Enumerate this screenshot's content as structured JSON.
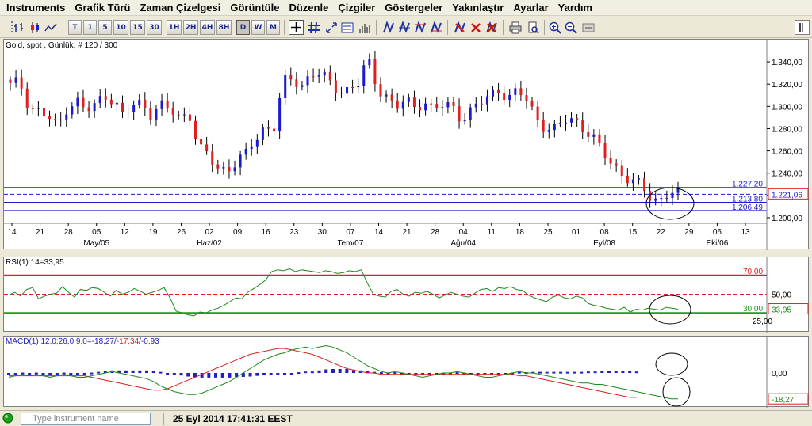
{
  "menu": [
    "Instruments",
    "Grafik Türü",
    "Zaman Çizelgesi",
    "Görüntüle",
    "Düzenle",
    "Çizgiler",
    "Göstergeler",
    "Yakınlaştır",
    "Ayarlar",
    "Yardım"
  ],
  "toolbar": {
    "period_buttons": [
      "T",
      "1",
      "5",
      "10",
      "15",
      "30",
      "1H",
      "2H",
      "4H",
      "8H",
      "D",
      "W",
      "M"
    ],
    "selected_period": "D"
  },
  "price_pane": {
    "title": "Gold, spot , Günlük, # 120 / 300",
    "axis_ticks": [
      "1.340,00",
      "1.320,00",
      "1.300,00",
      "1.280,00",
      "1.260,00",
      "1.240,00",
      "1.220,00",
      "1.200,00"
    ],
    "hlines": [
      {
        "label": "1.227,20",
        "value": 1227.2
      },
      {
        "label": "1.213,80",
        "value": 1213.8
      },
      {
        "label": "1.206,49",
        "value": 1206.49
      }
    ],
    "dashed_line_value": 1221.06,
    "last_price": "1.221,06",
    "day_labels": [
      "14",
      "21",
      "28",
      "05",
      "12",
      "19",
      "26",
      "02",
      "09",
      "16",
      "23",
      "30",
      "07",
      "14",
      "21",
      "28",
      "04",
      "11",
      "18",
      "25",
      "01",
      "08",
      "15",
      "22",
      "29",
      "06",
      "13"
    ],
    "month_labels": [
      {
        "text": "May/05",
        "index": 3
      },
      {
        "text": "Haz/02",
        "index": 7
      },
      {
        "text": "Tem/07",
        "index": 12
      },
      {
        "text": "Ağu/04",
        "index": 16
      },
      {
        "text": "Eyl/08",
        "index": 21
      },
      {
        "text": "Eki/06",
        "index": 25
      }
    ],
    "colors": {
      "up": "#1a1ad0",
      "down": "#e02020",
      "hline": "#1a1ad0"
    }
  },
  "rsi_pane": {
    "title": "RSI(1) 14=33,95",
    "levels": [
      {
        "label": "70,00",
        "value": 70,
        "color": "#e02020"
      },
      {
        "label": "30,00",
        "value": 30,
        "color": "#1aa01a"
      }
    ],
    "axis_ticks": [
      "50,00",
      "25,00"
    ],
    "last_value": "33,95",
    "series": [
      49,
      52,
      48,
      55,
      57,
      45,
      48,
      50,
      51,
      58,
      52,
      47,
      55,
      54,
      57,
      56,
      52,
      48,
      54,
      50,
      52,
      56,
      53,
      50,
      52,
      54,
      57,
      46,
      32,
      30,
      28,
      27,
      31,
      30,
      33,
      35,
      38,
      42,
      46,
      45,
      52,
      56,
      60,
      65,
      74,
      76,
      75,
      77,
      74,
      76,
      75,
      74,
      73,
      75,
      74,
      72,
      73,
      75,
      74,
      76,
      62,
      50,
      48,
      47,
      53,
      55,
      50,
      48,
      52,
      51,
      53,
      50,
      46,
      49,
      52,
      50,
      48,
      47,
      51,
      55,
      56,
      53,
      57,
      56,
      58,
      55,
      54,
      49,
      46,
      44,
      42,
      47,
      49,
      46,
      45,
      48,
      46,
      40,
      38,
      37,
      35,
      34,
      33,
      36,
      31,
      34,
      33,
      35,
      34,
      33,
      36,
      35,
      34
    ],
    "colors": {
      "line": "#1a8a1a"
    }
  },
  "macd_pane": {
    "title_prefix": "MACD(1) 12,0;26,0;9,0=",
    "title_main": "-18,27",
    "title_sep": "/",
    "title_signal": "-17,34",
    "title_hist": "/-0,93",
    "axis_ticks": [
      "0,00"
    ],
    "last_value": "-18,27",
    "macd": [
      -3,
      -2,
      -1,
      -2,
      -1,
      -2,
      -3,
      -2,
      -1,
      -2,
      -3,
      -3,
      -2,
      -1,
      0,
      1,
      0,
      -1,
      -2,
      -3,
      -4,
      -6,
      -9,
      -11,
      -13,
      -14,
      -15,
      -15,
      -14,
      -12,
      -10,
      -8,
      -6,
      -3,
      0,
      3,
      6,
      9,
      11,
      13,
      14,
      16,
      17,
      18,
      17,
      18,
      19,
      18,
      16,
      14,
      11,
      8,
      5,
      3,
      1,
      0,
      1,
      0,
      -1,
      -2,
      -3,
      -2,
      -1,
      0,
      0,
      1,
      0,
      -1,
      -2,
      -3,
      -3,
      -2,
      -1,
      0,
      1,
      0,
      0,
      -1,
      -2,
      -3,
      -4,
      -5,
      -6,
      -7,
      -7,
      -8,
      -8,
      -9,
      -10,
      -11,
      -12,
      -13,
      -14,
      -15,
      -16,
      -17,
      -18,
      -18
    ],
    "signal": [
      -2,
      -2,
      -2,
      -2,
      -2,
      -2,
      -2,
      -2,
      -2,
      -2,
      -2,
      -2,
      -3,
      -4,
      -5,
      -6,
      -7,
      -8,
      -9,
      -10,
      -11,
      -12,
      -12,
      -11,
      -9,
      -7,
      -5,
      -3,
      -1,
      1,
      3,
      5,
      7,
      9,
      11,
      13,
      14,
      15,
      16,
      17,
      17,
      16,
      15,
      14,
      13,
      11,
      9,
      7,
      5,
      3,
      2,
      1,
      0,
      0,
      -1,
      -1,
      -1,
      -1,
      -1,
      -1,
      -1,
      -1,
      -1,
      -1,
      -1,
      -1,
      -1,
      -1,
      -1,
      -1,
      -1,
      -1,
      -1,
      -1,
      -2,
      -2,
      -3,
      -4,
      -5,
      -6,
      -7,
      -8,
      -9,
      -10,
      -11,
      -12,
      -13,
      -14,
      -15,
      -16,
      -17,
      -17
    ],
    "colors": {
      "macd": "#1a8a1a",
      "signal": "#e02020",
      "hist": "#2020c0"
    }
  },
  "status": {
    "search_placeholder": "Type instrument name",
    "datetime": "25 Eyl 2014 17:41:31 EEST"
  }
}
